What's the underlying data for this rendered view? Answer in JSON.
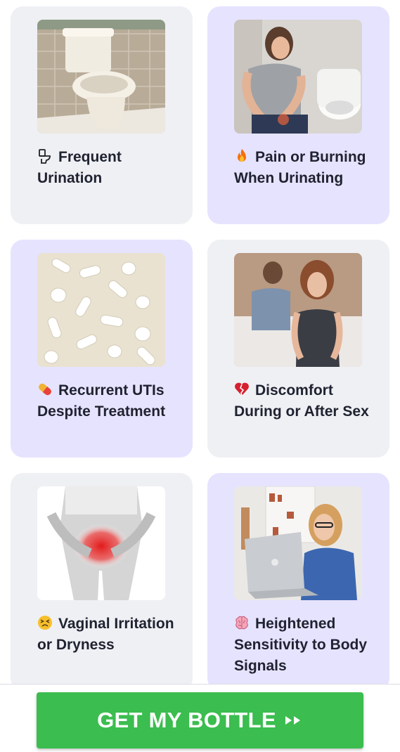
{
  "cards": [
    {
      "title": "Frequent Urination",
      "icon": "toilet-icon",
      "image": "toilet-photo",
      "bg": "#eff0f4"
    },
    {
      "title": "Pain or Burning When Urinating",
      "icon": "fire-icon",
      "image": "woman-pain-photo",
      "bg": "#e6e3ff"
    },
    {
      "title": "Recurrent UTIs Despite Treatment",
      "icon": "pill-icon",
      "image": "pills-photo",
      "bg": "#e6e3ff"
    },
    {
      "title": "Discomfort During or After Sex",
      "icon": "broken-heart-icon",
      "image": "couple-photo",
      "bg": "#eff0f4"
    },
    {
      "title": "Vaginal Irritation or Dryness",
      "icon": "persevering-face-icon",
      "image": "pelvic-pain-photo",
      "bg": "#eff0f4"
    },
    {
      "title": "Heightened Sensitivity to Body Signals",
      "icon": "brain-icon",
      "image": "woman-laptop-photo",
      "bg": "#e6e3ff"
    }
  ],
  "cta": {
    "label": "GET MY BOTTLE",
    "icon": "double-play-icon",
    "color": "#3bbd4f"
  }
}
